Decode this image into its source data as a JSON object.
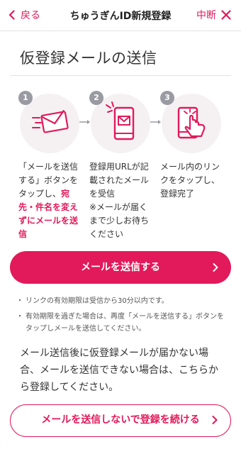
{
  "header": {
    "back_label": "戻る",
    "title": "ちゅうぎんID新規登録",
    "quit_label": "中断"
  },
  "page_title": "仮登録メールの送信",
  "steps": [
    {
      "number": "1",
      "icon": "send-mail-icon",
      "text": [
        "「メールを送信する」ボタンをタップし、",
        "宛先・件名を変えずにメールを送信"
      ]
    },
    {
      "number": "2",
      "icon": "phone-mail-icon",
      "text": [
        "登録用URLが記載されたメールを受信",
        "※メールが届くまで少しお待ちください"
      ]
    },
    {
      "number": "3",
      "icon": "phone-tap-icon",
      "text": [
        "メール内のリンクをタップし、登録完了"
      ]
    }
  ],
  "primary_button": "メールを送信する",
  "notes": [
    "リンクの有効期限は受信から30分以内です。",
    "有効期限を過ぎた場合は、再度「メールを送信する」ボタンをタップしメールを送信してください。"
  ],
  "info_text": "メール送信後に仮登録メールが届かない場合、メールを送信できない場合は、こちらから登録してください。",
  "secondary_button": "メールを送信しないで登録を続ける",
  "colors": {
    "accent": "#e2195a",
    "step_bg": "#f5f1f3",
    "badge": "#9a9aa2"
  }
}
